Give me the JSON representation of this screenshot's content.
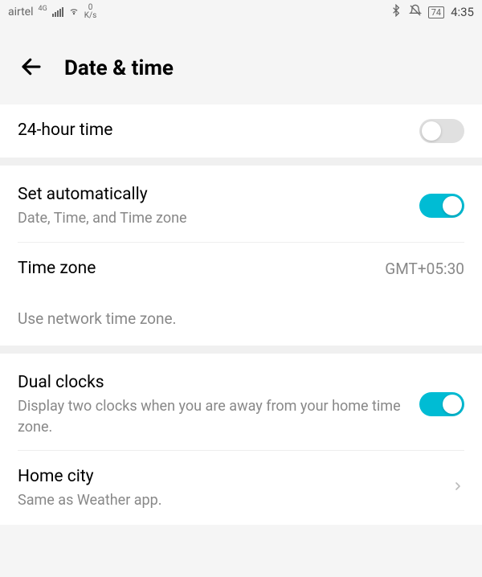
{
  "status_bar": {
    "carrier": "airtel",
    "network_type": "4G",
    "data_speed_value": "0",
    "data_speed_unit": "K/s",
    "battery_level": "74",
    "time": "4:35"
  },
  "header": {
    "title": "Date & time"
  },
  "settings": {
    "twenty_four_hour": {
      "title": "24-hour time",
      "enabled": false
    },
    "set_automatically": {
      "title": "Set automatically",
      "subtitle": "Date, Time, and Time zone",
      "enabled": true
    },
    "time_zone": {
      "title": "Time zone",
      "value": "GMT+05:30"
    },
    "time_zone_note": "Use network time zone.",
    "dual_clocks": {
      "title": "Dual clocks",
      "subtitle": "Display two clocks when you are away from your home time zone.",
      "enabled": true
    },
    "home_city": {
      "title": "Home city",
      "subtitle": "Same as Weather app."
    }
  }
}
